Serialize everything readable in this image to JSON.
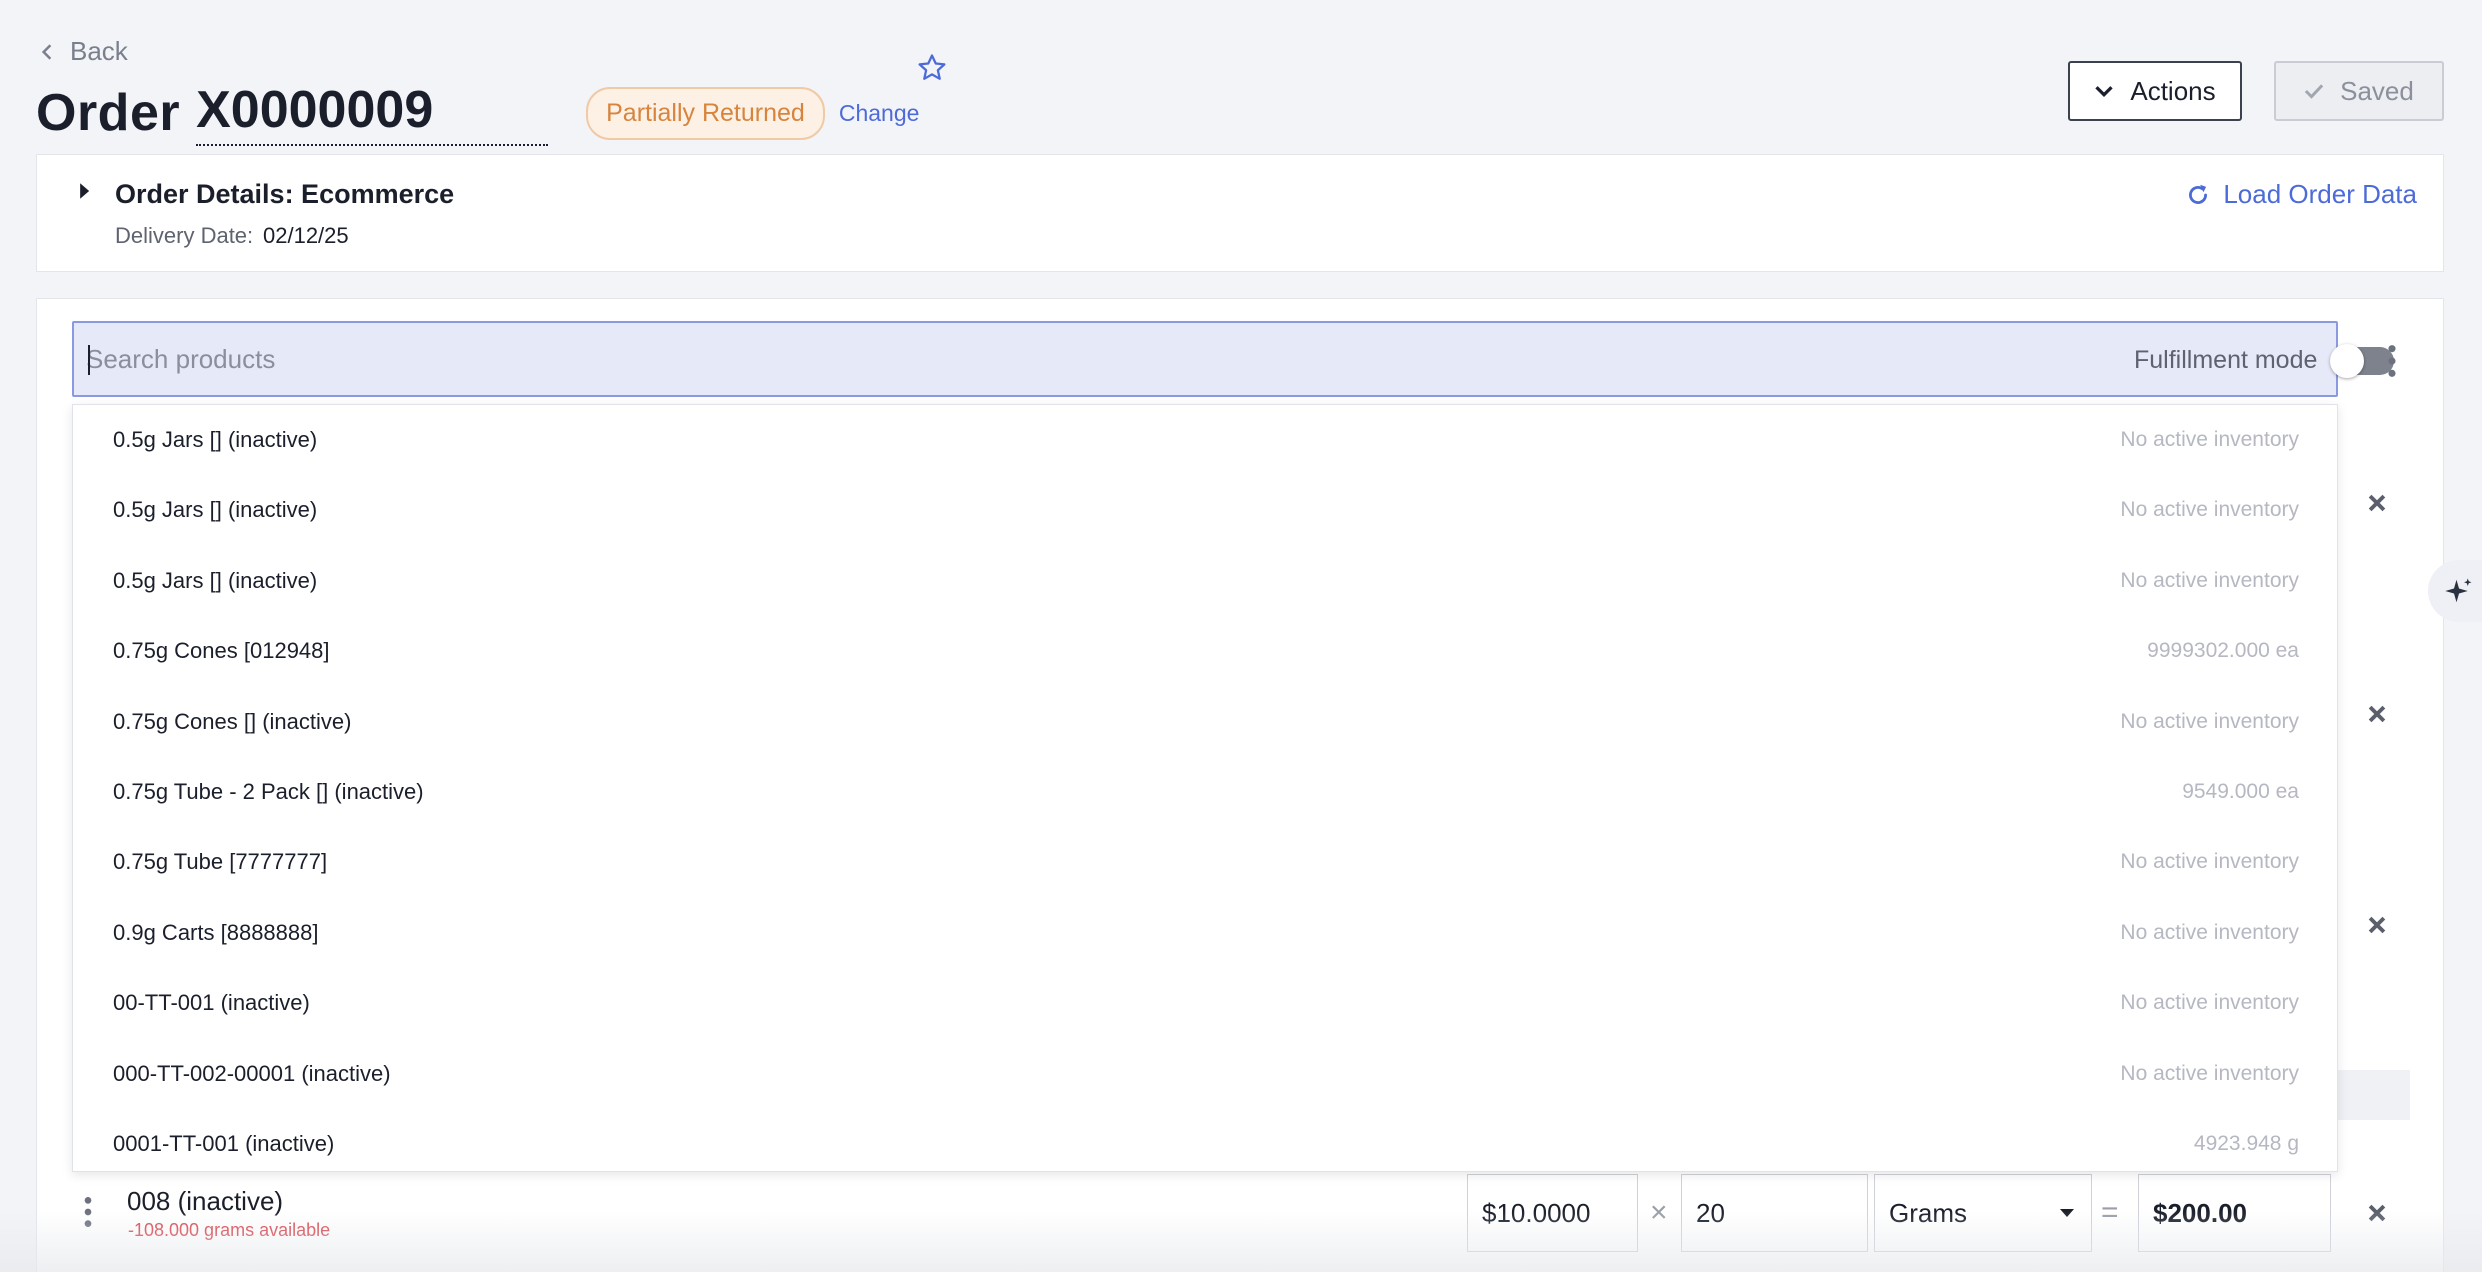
{
  "header": {
    "back_label": "Back",
    "order_word": "Order",
    "order_number": "X0000009",
    "status": "Partially Returned",
    "change_label": "Change",
    "actions_label": "Actions",
    "saved_label": "Saved"
  },
  "details": {
    "title": "Order Details: Ecommerce",
    "delivery_label": "Delivery Date:",
    "delivery_value": "02/12/25",
    "load_label": "Load Order Data"
  },
  "search": {
    "placeholder": "Search products",
    "fulfillment_label": "Fulfillment mode",
    "fulfillment_on": false
  },
  "dropdown_items": [
    {
      "name": "0.5g Jars [] (inactive)",
      "stock": "No active inventory"
    },
    {
      "name": "0.5g Jars [] (inactive)",
      "stock": "No active inventory"
    },
    {
      "name": "0.5g Jars [] (inactive)",
      "stock": "No active inventory"
    },
    {
      "name": "0.75g Cones [012948]",
      "stock": "9999302.000 ea"
    },
    {
      "name": "0.75g Cones [] (inactive)",
      "stock": "No active inventory"
    },
    {
      "name": "0.75g Tube - 2 Pack [] (inactive)",
      "stock": "9549.000 ea"
    },
    {
      "name": "0.75g Tube [7777777]",
      "stock": "No active inventory"
    },
    {
      "name": "0.9g Carts [8888888]",
      "stock": "No active inventory"
    },
    {
      "name": "00-TT-001 (inactive)",
      "stock": "No active inventory"
    },
    {
      "name": "000-TT-002-00001 (inactive)",
      "stock": "No active inventory"
    },
    {
      "name": "0001-TT-001 (inactive)",
      "stock": "4923.948 g"
    }
  ],
  "line_item": {
    "name": "008 (inactive)",
    "available": "-108.000 grams available",
    "price": "$10.0000",
    "times": "×",
    "quantity": "20",
    "unit": "Grams",
    "equals": "=",
    "total": "$200.00"
  },
  "colors": {
    "accent": "#4d6bd8",
    "status_text": "#d7843e",
    "status_bg": "#fdf0e4",
    "warning": "#d9474f"
  }
}
